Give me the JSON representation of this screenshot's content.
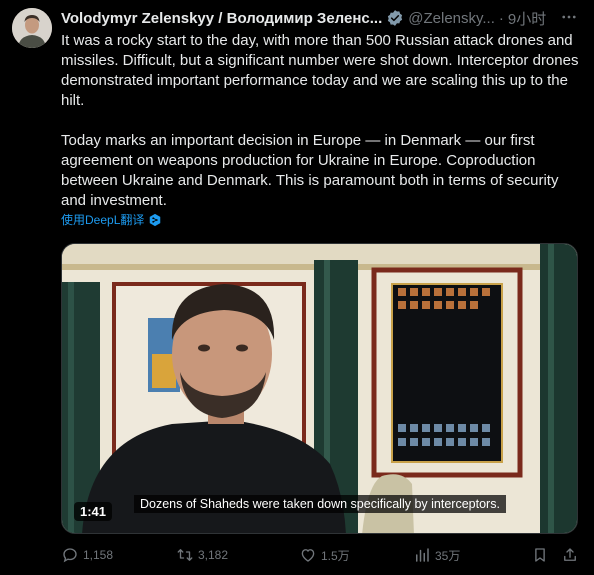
{
  "author": {
    "name": "Volodymyr Zelenskyy / Володимир Зеленс...",
    "handle": "@Zelensky...",
    "separator": "·",
    "time": "9小时"
  },
  "post": {
    "paragraphs": [
      "It was a rocky start to the day, with more than 500 Russian attack drones and missiles. Difficult, but a significant number were shot down. Interceptor drones demonstrated important performance today and we are scaling this up to the hilt.",
      "Today marks an important decision in Europe — in Denmark — our first agreement on weapons production for Ukraine in Europe. Coproduction between Ukraine and Denmark. This is paramount both in terms of security and investment."
    ],
    "translate_label": "使用DeepL翻译"
  },
  "video": {
    "duration": "1:41",
    "caption": "Dozens of Shaheds were taken down specifically by interceptors."
  },
  "actions": {
    "replies": "1,158",
    "reposts": "3,182",
    "likes": "1.5万",
    "views": "35万"
  },
  "colors": {
    "background": "#000000",
    "text": "#e7e9ea",
    "muted": "#71767b",
    "link": "#1d9bf0",
    "verified": "#829aab"
  },
  "icons": [
    "verified-badge-icon",
    "more-icon",
    "deepl-icon",
    "reply-icon",
    "repost-icon",
    "like-icon",
    "views-icon",
    "bookmark-icon",
    "share-icon"
  ]
}
